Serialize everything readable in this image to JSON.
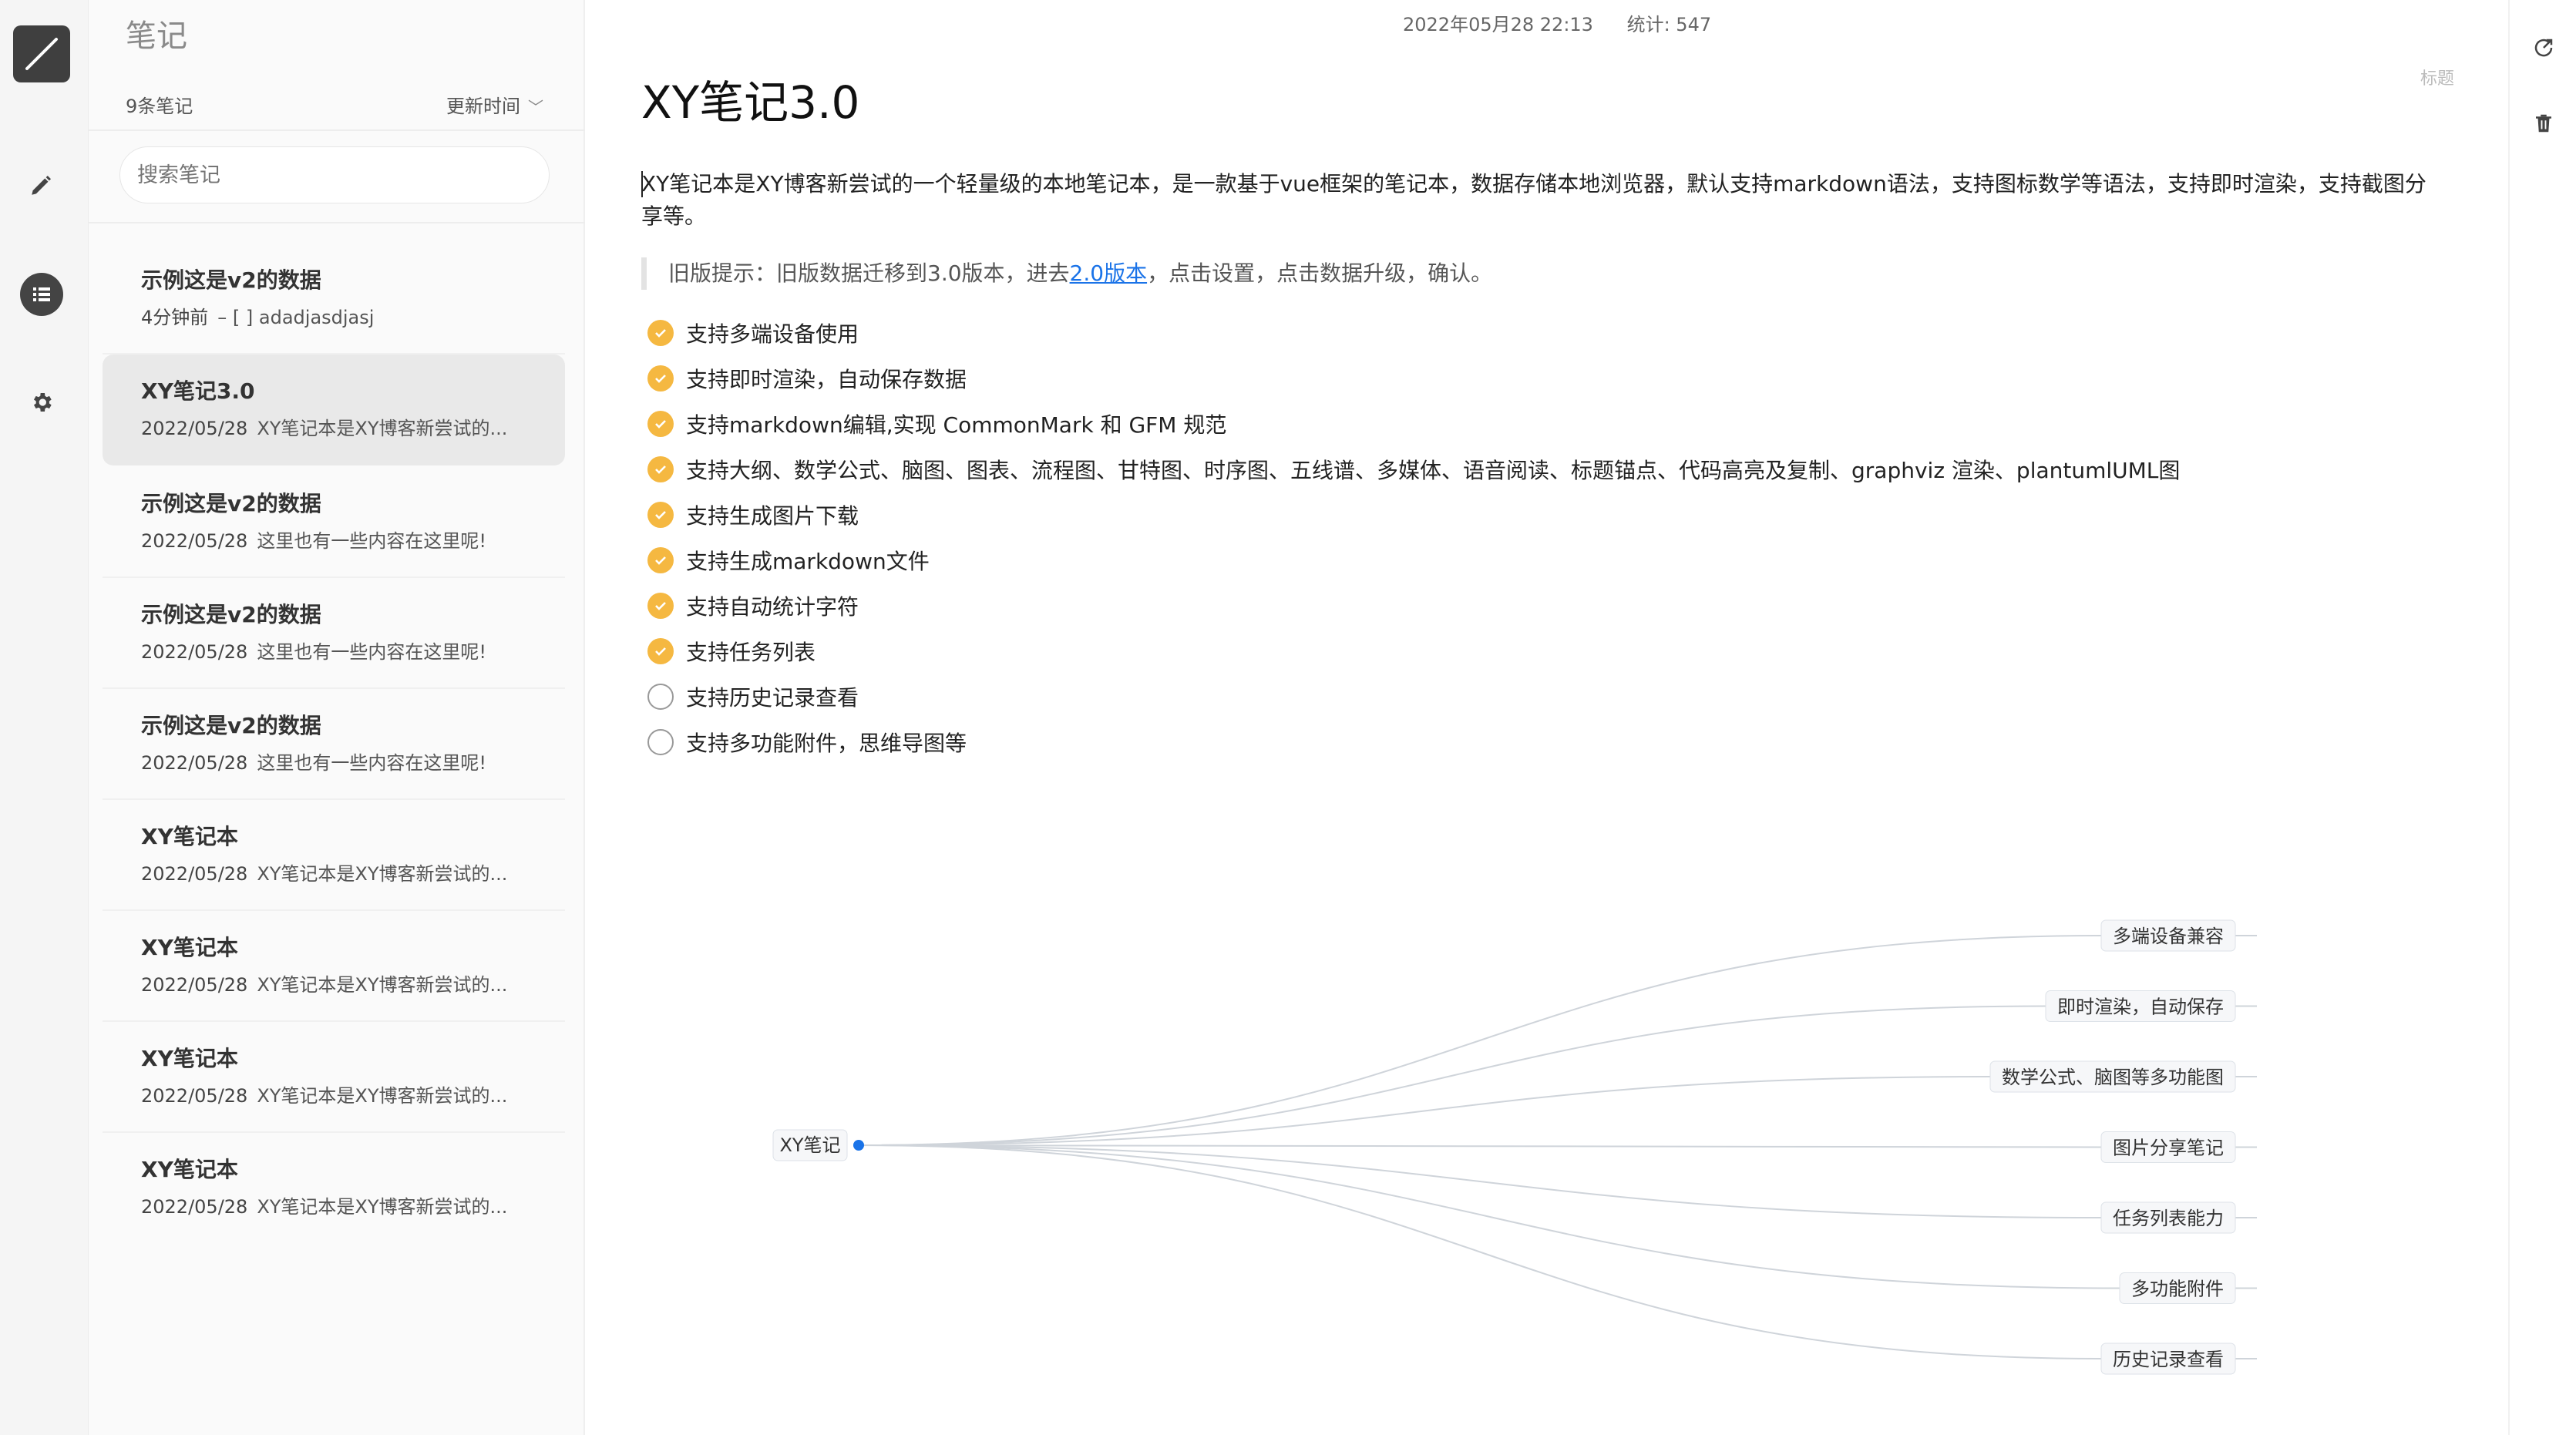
{
  "sidebar_icons": [
    "pen-logo",
    "pencil-icon",
    "list-icon",
    "gear-icon"
  ],
  "list_panel": {
    "title": "笔记",
    "count": "9条笔记",
    "sort_label": "更新时间",
    "search_placeholder": "搜索笔记",
    "items": [
      {
        "title": "示例这是v2的数据",
        "date": "4分钟前",
        "preview": "– [ ] adadjasdjasj"
      },
      {
        "title": "XY笔记3.0",
        "date": "2022/05/28",
        "preview": "XY笔记本是XY博客新尝试的..."
      },
      {
        "title": "示例这是v2的数据",
        "date": "2022/05/28",
        "preview": "这里也有一些内容在这里呢!"
      },
      {
        "title": "示例这是v2的数据",
        "date": "2022/05/28",
        "preview": "这里也有一些内容在这里呢!"
      },
      {
        "title": "示例这是v2的数据",
        "date": "2022/05/28",
        "preview": "这里也有一些内容在这里呢!"
      },
      {
        "title": "XY笔记本",
        "date": "2022/05/28",
        "preview": "XY笔记本是XY博客新尝试的..."
      },
      {
        "title": "XY笔记本",
        "date": "2022/05/28",
        "preview": "XY笔记本是XY博客新尝试的..."
      },
      {
        "title": "XY笔记本",
        "date": "2022/05/28",
        "preview": "XY笔记本是XY博客新尝试的..."
      },
      {
        "title": "XY笔记本",
        "date": "2022/05/28",
        "preview": "XY笔记本是XY博客新尝试的..."
      }
    ]
  },
  "editor": {
    "timestamp": "2022年05月28 22:13",
    "stats": "统计: 547",
    "title_hint": "标题",
    "title": "XY笔记3.0",
    "paragraph": "XY笔记本是XY博客新尝试的一个轻量级的本地笔记本，是一款基于vue框架的笔记本，数据存储本地浏览器，默认支持markdown语法，支持图标数学等语法，支持即时渲染，支持截图分享等。",
    "quote_before": "旧版提示：旧版数据迁移到3.0版本，进去",
    "quote_link": "2.0版本",
    "quote_after": "，点击设置，点击数据升级，确认。",
    "tasks": [
      {
        "text": "支持多端设备使用",
        "done": true
      },
      {
        "text": "支持即时渲染，自动保存数据",
        "done": true
      },
      {
        "text": "支持markdown编辑,实现 CommonMark 和 GFM 规范",
        "done": true
      },
      {
        "text": "支持大纲、数学公式、脑图、图表、流程图、甘特图、时序图、五线谱、多媒体、语音阅读、标题锚点、代码高亮及复制、graphviz 渲染、plantumlUML图",
        "done": true
      },
      {
        "text": "支持生成图片下载",
        "done": true
      },
      {
        "text": "支持生成markdown文件",
        "done": true
      },
      {
        "text": "支持自动统计字符",
        "done": true
      },
      {
        "text": "支持任务列表",
        "done": true
      },
      {
        "text": "支持历史记录查看",
        "done": false
      },
      {
        "text": "支持多功能附件，思维导图等",
        "done": false
      }
    ],
    "mindmap": {
      "root": "XY笔记",
      "children": [
        "多端设备兼容",
        "即时渲染，自动保存",
        "数学公式、脑图等多功能图",
        "图片分享笔记",
        "任务列表能力",
        "多功能附件",
        "历史记录查看"
      ]
    }
  },
  "right_icons": [
    "share-icon",
    "trash-icon"
  ],
  "colors": {
    "accent": "#f5b841",
    "link": "#1a73e8",
    "mind_dot": "#1a73e8"
  }
}
